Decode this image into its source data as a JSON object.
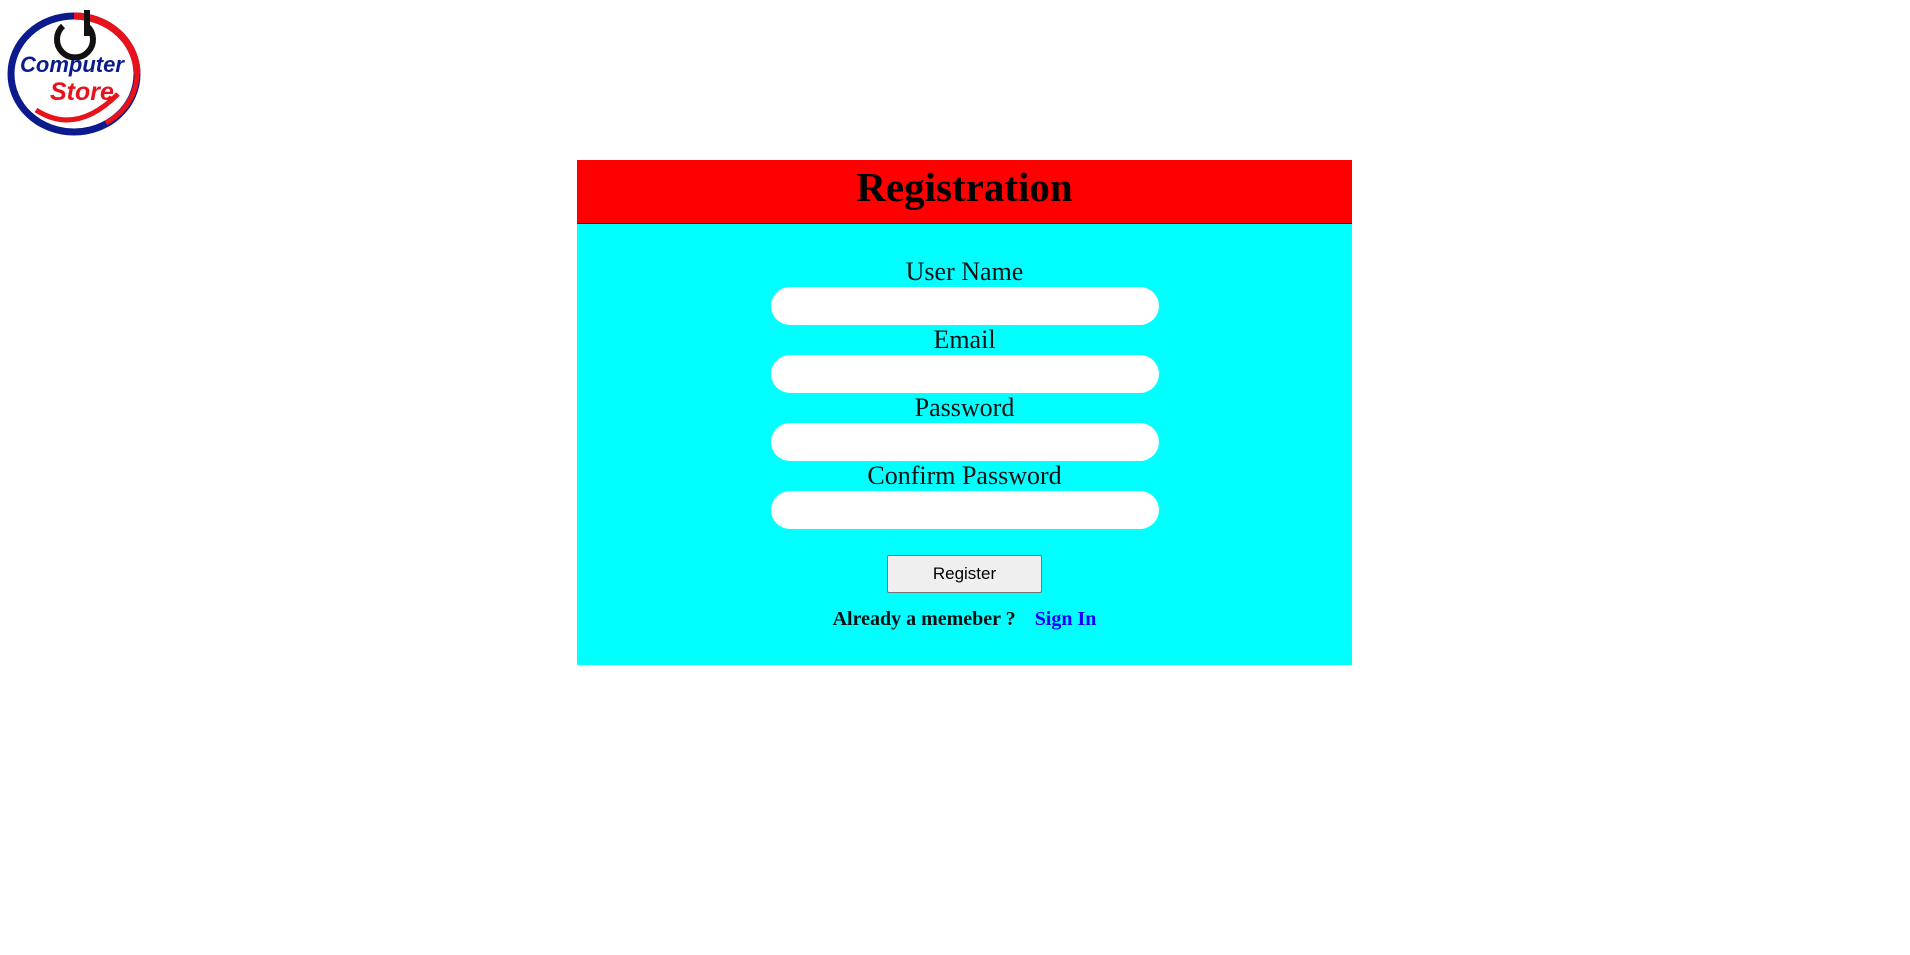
{
  "logo": {
    "line1": "Computer",
    "line2": "Store"
  },
  "registration": {
    "title": "Registration",
    "fields": [
      {
        "label": "User Name",
        "value": "",
        "placeholder": ""
      },
      {
        "label": "Email",
        "value": "",
        "placeholder": ""
      },
      {
        "label": "Password",
        "value": "",
        "placeholder": ""
      },
      {
        "label": "Confirm Password",
        "value": "",
        "placeholder": ""
      }
    ],
    "register_label": "Register",
    "signin_prompt": "Already a memeber ?",
    "signin_link": "Sign In"
  },
  "colors": {
    "header_bg": "#ff0000",
    "body_bg": "#00ffff",
    "link": "#1a00ff",
    "logo_red": "#e8121b",
    "logo_blue": "#0b1a8c"
  }
}
